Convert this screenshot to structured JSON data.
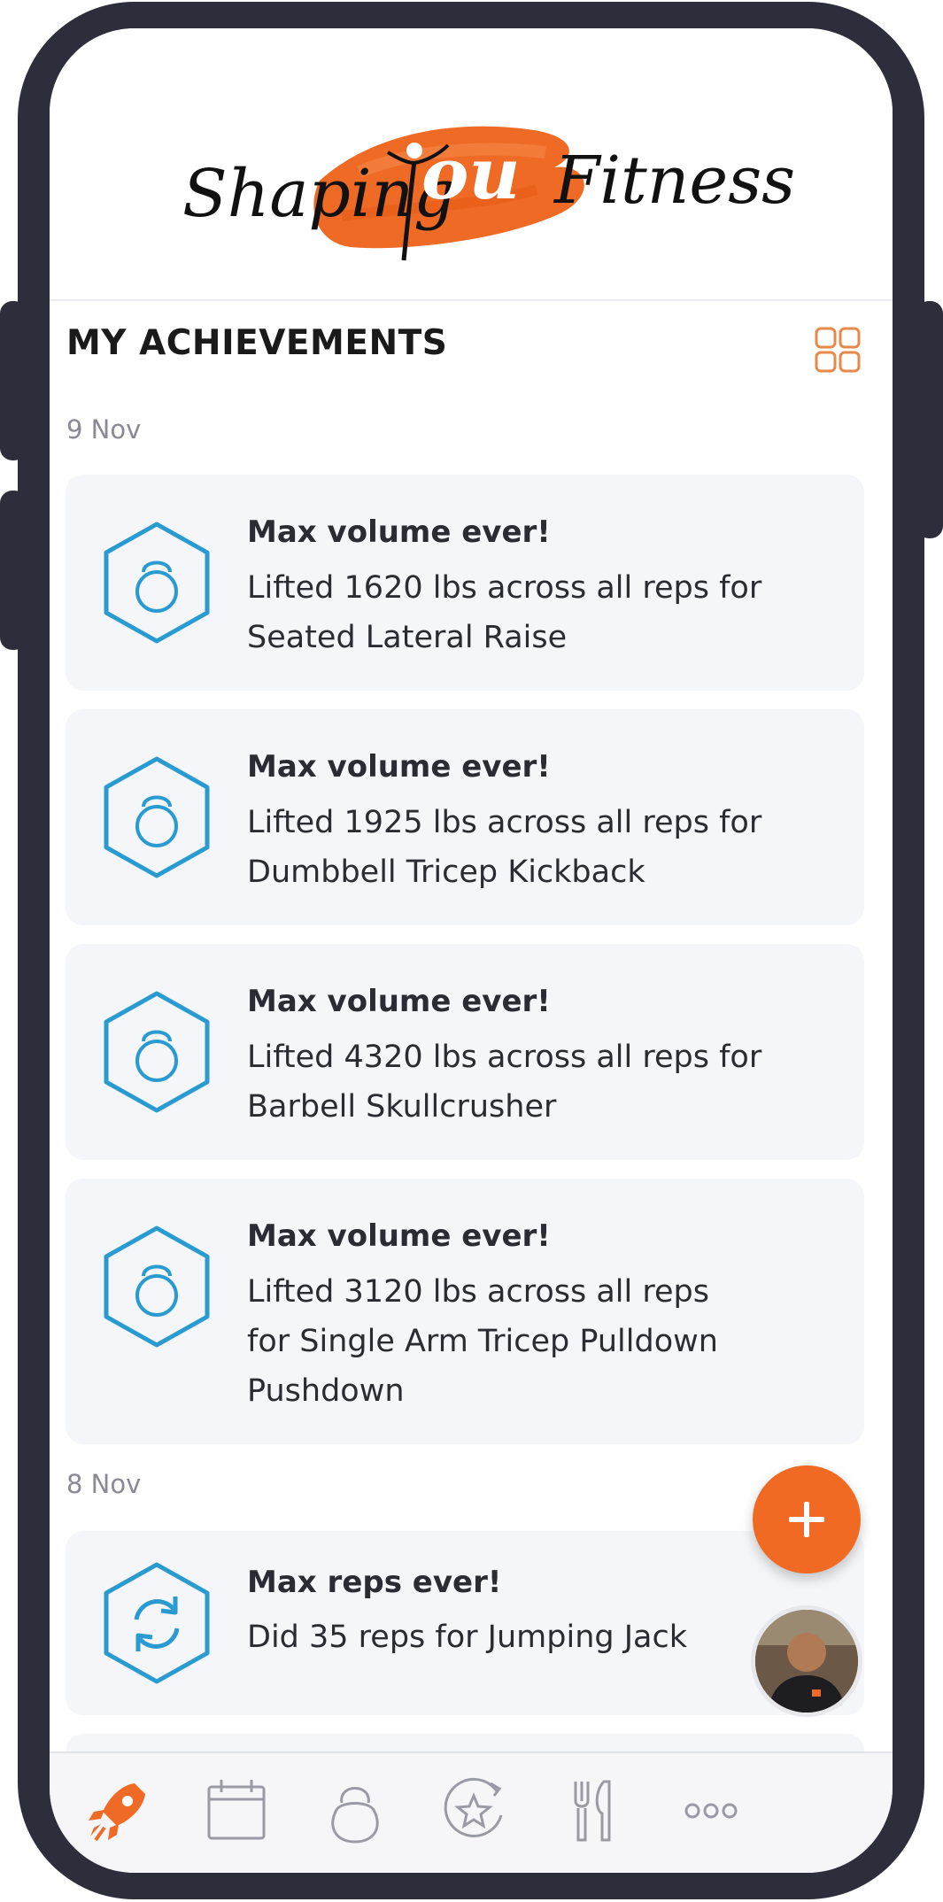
{
  "brand": {
    "logo_alt": "Shaping You Fitness",
    "accent": "#f06a24",
    "badge_color": "#2a9bd0"
  },
  "header": {
    "title": "MY ACHIEVEMENTS",
    "view_toggle_icon": "grid-icon"
  },
  "groups": [
    {
      "date": "9 Nov",
      "achievements": [
        {
          "icon": "kettlebell-icon",
          "title": "Max volume ever!",
          "line1": "Lifted 1620 lbs across all reps for",
          "line2": "Seated Lateral Raise",
          "line3": ""
        },
        {
          "icon": "kettlebell-icon",
          "title": "Max volume ever!",
          "line1": "Lifted 1925 lbs across all reps for",
          "line2": "Dumbbell Tricep Kickback",
          "line3": ""
        },
        {
          "icon": "kettlebell-icon",
          "title": "Max volume ever!",
          "line1": "Lifted 4320 lbs across all reps for",
          "line2": "Barbell Skullcrusher",
          "line3": ""
        },
        {
          "icon": "kettlebell-icon",
          "title": "Max volume ever!",
          "line1": "Lifted 3120 lbs across all reps",
          "line2": "for Single Arm Tricep Pulldown",
          "line3": "Pushdown"
        }
      ]
    },
    {
      "date": "8 Nov",
      "achievements": [
        {
          "icon": "repeat-icon",
          "title": "Max reps ever!",
          "line1": "Did 35 reps for Jumping Jack",
          "line2": "",
          "line3": ""
        }
      ]
    }
  ],
  "fab": {
    "label": "+",
    "icon": "plus-icon"
  },
  "tabs": [
    {
      "icon": "rocket-icon",
      "active": true
    },
    {
      "icon": "calendar-icon",
      "active": false
    },
    {
      "icon": "kettlebell-icon",
      "active": false
    },
    {
      "icon": "star-badge-icon",
      "active": false
    },
    {
      "icon": "fork-knife-icon",
      "active": false
    },
    {
      "icon": "more-icon",
      "active": false
    }
  ]
}
